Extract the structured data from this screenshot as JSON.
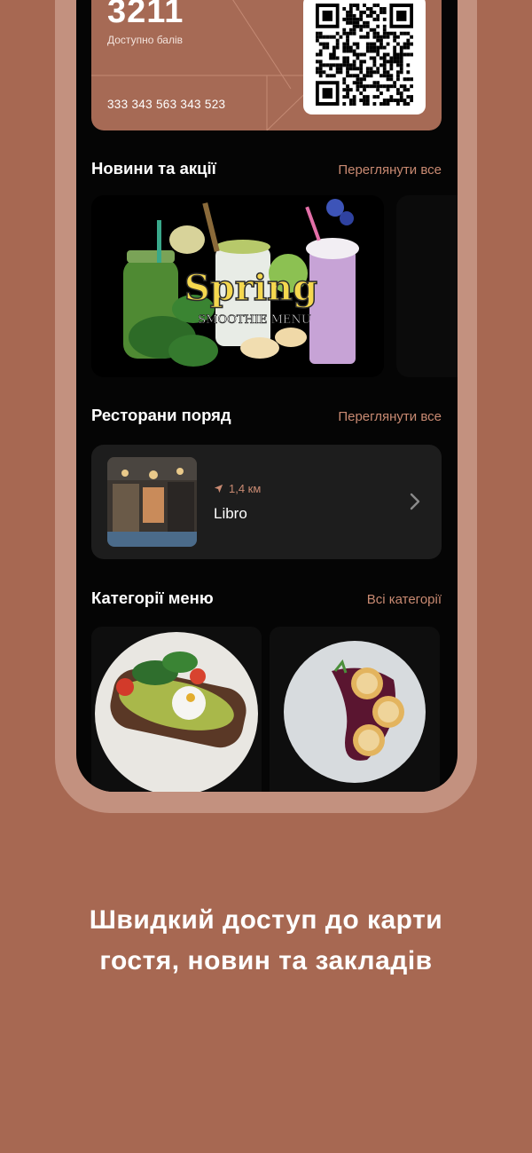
{
  "card": {
    "points": "3211",
    "points_label": "Доступно балів",
    "card_number": "333 343 563 343 523"
  },
  "news": {
    "title": "Новини та акції",
    "link": "Переглянути все",
    "promo": {
      "headline": "Spring",
      "subline": "SMOOTHIE MENU"
    }
  },
  "restaurants": {
    "title": "Ресторани поряд",
    "link": "Переглянути все",
    "items": [
      {
        "distance": "1,4 км",
        "name": "Libro"
      }
    ]
  },
  "categories": {
    "title": "Категорії меню",
    "link": "Всі категорії"
  },
  "tagline": {
    "line1": "Швидкий доступ до карти",
    "line2": "гостя, новин та закладів"
  },
  "colors": {
    "background": "#a76852",
    "accent": "#c98a72",
    "card": "#a66a55",
    "screen": "#050505"
  },
  "icons": [
    "location-arrow-icon",
    "chevron-right-icon",
    "qr-code-icon"
  ]
}
